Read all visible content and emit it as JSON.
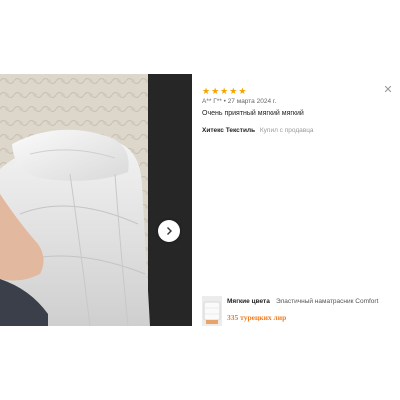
{
  "review": {
    "rating": 5,
    "star_char": "★",
    "author": "А** Г**",
    "date": "27 марта 2024 г.",
    "text": "Очень приятный мягкий мягкий"
  },
  "seller": {
    "name": "Хитекс Текстиль",
    "purchased_label": "Купил с продавца"
  },
  "product": {
    "brand": "Мягкие цвета",
    "name": "Эластичный наматрасник Comfort",
    "price": "335 турецких лир"
  },
  "icons": {
    "close": "close-icon",
    "next": "chevron-right-icon"
  },
  "colors": {
    "star": "#f5a300",
    "price": "#f27a1a"
  }
}
